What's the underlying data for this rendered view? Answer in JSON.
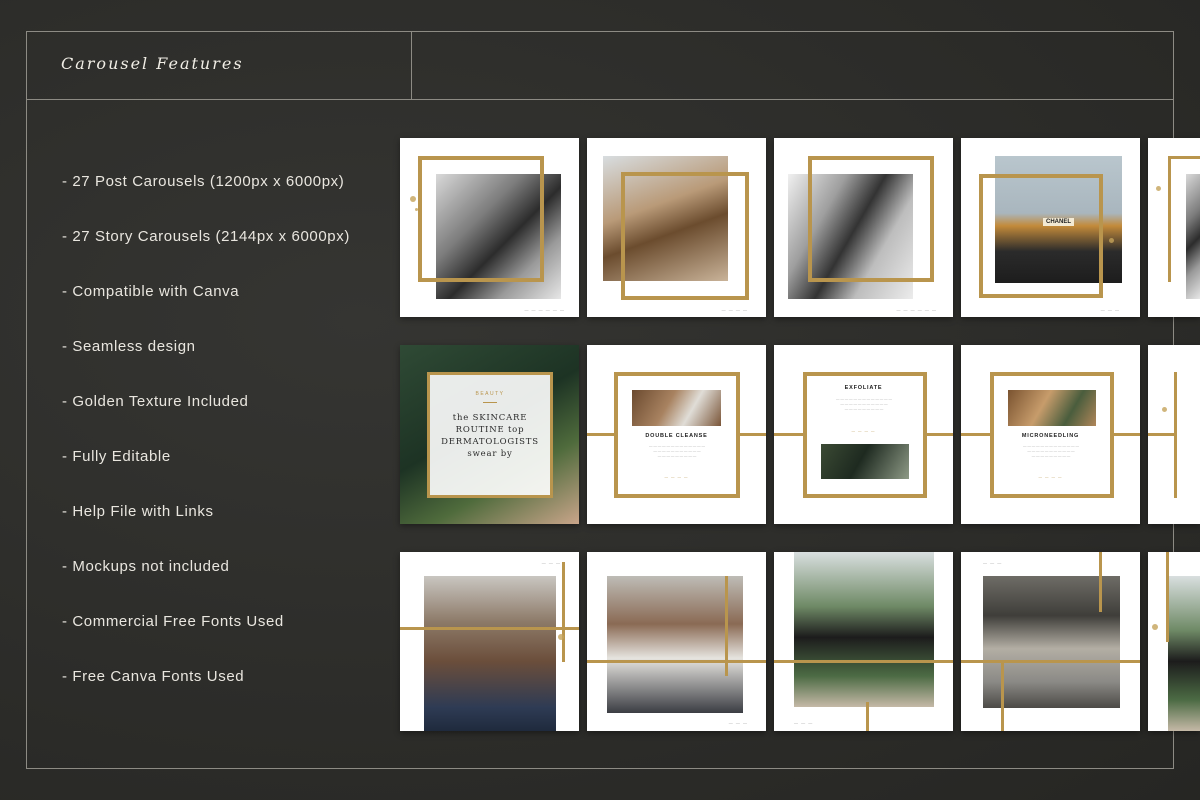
{
  "header": {
    "title": "Carousel Features"
  },
  "features": [
    "- 27 Post Carousels (1200px x 6000px)",
    "- 27 Story Carousels (2144px x 6000px)",
    "- Compatible with   Canva",
    "- Seamless design",
    "- Golden Texture Included",
    "- Fully Editable",
    "- Help File with Links",
    "- Mockups not included",
    "- Commercial Free Fonts Used",
    "- Free Canva Fonts Used"
  ],
  "preview": {
    "quote_card": {
      "tag": "BEAUTY",
      "text": "the SKINCARE ROUTINE top DERMATOLOGISTS swear by"
    },
    "steps": [
      {
        "title": "DOUBLE CLEANSE"
      },
      {
        "title": "EXFOLIATE"
      },
      {
        "title": "MICRONEEDLING"
      }
    ],
    "perfume_label": "CHANEL"
  },
  "colors": {
    "background": "#2e2e2b",
    "frame_line": "#8d8b84",
    "gold": "#b9954d",
    "text": "#e9e6df"
  }
}
